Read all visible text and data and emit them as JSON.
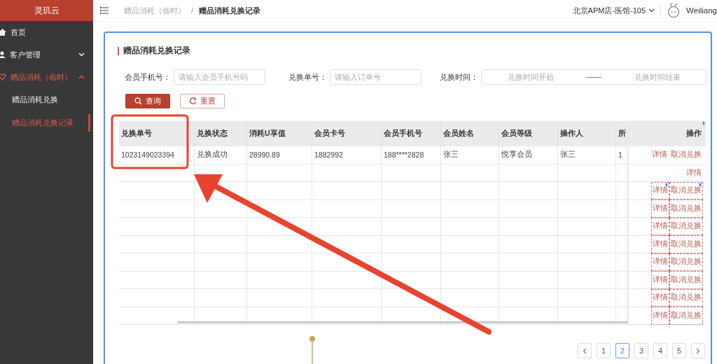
{
  "sidebar": {
    "logo": "灵玑云",
    "items": [
      {
        "label": "首页",
        "selected": false
      },
      {
        "label": "客户管理",
        "selected": false,
        "expanded": false
      },
      {
        "label": "赠品消耗（临时）",
        "selected": true,
        "expanded": true,
        "children": [
          {
            "label": "赠品消耗兑换",
            "selected": false
          },
          {
            "label": "赠品消耗兑换记录",
            "selected": true
          }
        ]
      }
    ]
  },
  "topbar": {
    "breadcrumb": [
      {
        "label": "赠品消耗（临时）",
        "current": false
      },
      {
        "label": "赠品消耗兑换记录",
        "current": true
      }
    ],
    "separator": "/",
    "store": "北京APM店-医馆-105",
    "user": "Weiliang"
  },
  "page_title": "赠品消耗兑换记录",
  "filters": [
    {
      "kind": "text",
      "label": "会员手机号：",
      "placeholder": "请输入会员手机号码"
    },
    {
      "kind": "text",
      "label": "兑换单号：",
      "placeholder": "请输入订单号"
    },
    {
      "kind": "range",
      "label": "兑换时间：",
      "start_placeholder": "兑换时间开始",
      "end_placeholder": "兑换时间结束"
    }
  ],
  "buttons": [
    {
      "label": "查询",
      "kind": "primary"
    },
    {
      "label": "重置",
      "kind": "secondary"
    }
  ],
  "table": {
    "columns": [
      "兑换单号",
      "兑换状态",
      "消耗U享值",
      "会员卡号",
      "会员手机号",
      "会员姓名",
      "会员等级",
      "操作人",
      "所"
    ],
    "action_column": "操作",
    "rows": [
      {
        "cells": [
          "1023149023394",
          "兑换成功",
          "28990.89",
          "1882992",
          "188****2828",
          "张三",
          "悦享会员",
          "张三",
          "1"
        ],
        "actions": [
          "详情",
          "取消兑换"
        ],
        "outlined": false
      },
      {
        "cells": [],
        "actions": [
          "详情"
        ],
        "outlined": false
      },
      {
        "cells": [],
        "actions": [
          "详情",
          "取消兑换"
        ],
        "outlined": true
      },
      {
        "cells": [],
        "actions": [
          "详情",
          "取消兑换"
        ],
        "outlined": true
      },
      {
        "cells": [],
        "actions": [
          "详情",
          "取消兑换"
        ],
        "outlined": true
      },
      {
        "cells": [],
        "actions": [
          "详情",
          "取消兑换"
        ],
        "outlined": true
      },
      {
        "cells": [],
        "actions": [
          "详情",
          "取消兑换"
        ],
        "outlined": true
      },
      {
        "cells": [],
        "actions": [
          "详情",
          "取消兑换"
        ],
        "outlined": true
      },
      {
        "cells": [],
        "actions": [
          "详情",
          "取消兑换"
        ],
        "outlined": true
      },
      {
        "cells": [],
        "actions": [
          "详情",
          "取消兑换"
        ],
        "outlined": true
      }
    ]
  },
  "pagination": [
    {
      "label": "1",
      "selected": false
    },
    {
      "label": "2",
      "selected": true
    },
    {
      "label": "3",
      "selected": false
    },
    {
      "label": "4",
      "selected": false
    },
    {
      "label": "5",
      "selected": false
    }
  ]
}
